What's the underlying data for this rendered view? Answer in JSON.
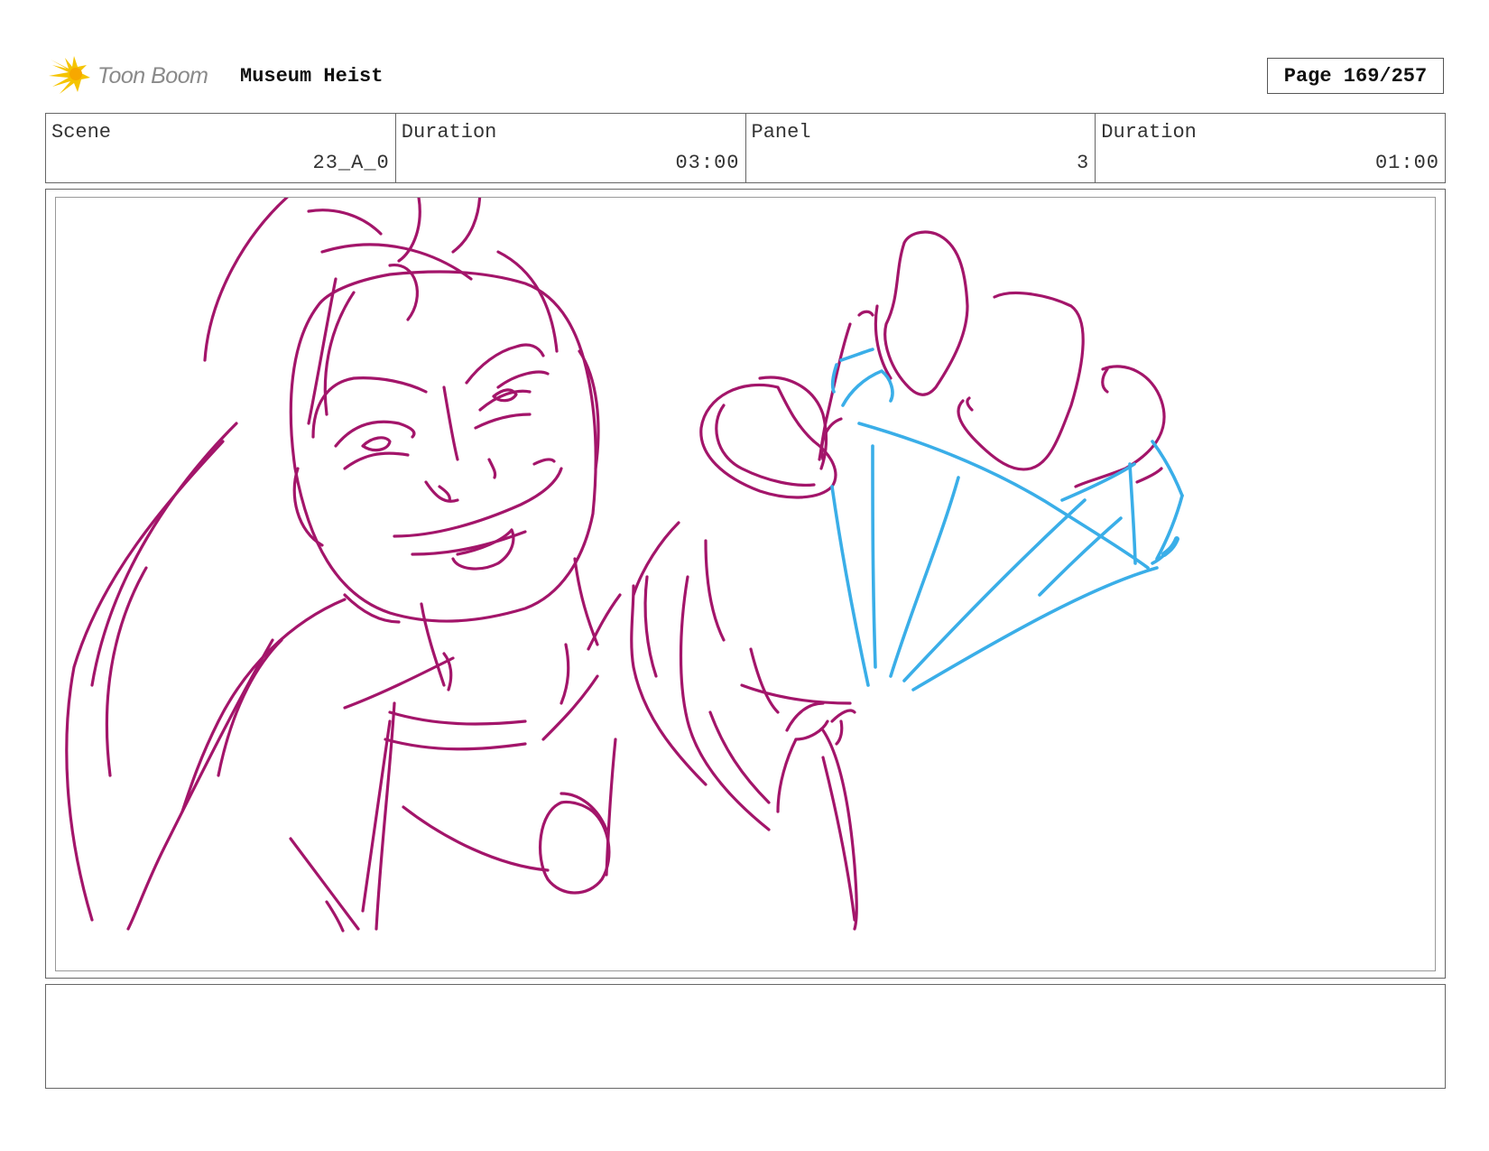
{
  "header": {
    "logo_text": "Toon Boom",
    "project_title": "Museum Heist",
    "page_indicator": "Page 169/257"
  },
  "info": {
    "scene_label": "Scene",
    "scene_value": "23_A_0",
    "scene_duration_label": "Duration",
    "scene_duration_value": "03:00",
    "panel_label": "Panel",
    "panel_value": "3",
    "panel_duration_label": "Duration",
    "panel_duration_value": "01:00"
  },
  "colors": {
    "sketch_character": "#a3156a",
    "sketch_gem": "#3aaee8",
    "logo_accent": "#f5c400"
  },
  "notes": {
    "text": ""
  }
}
